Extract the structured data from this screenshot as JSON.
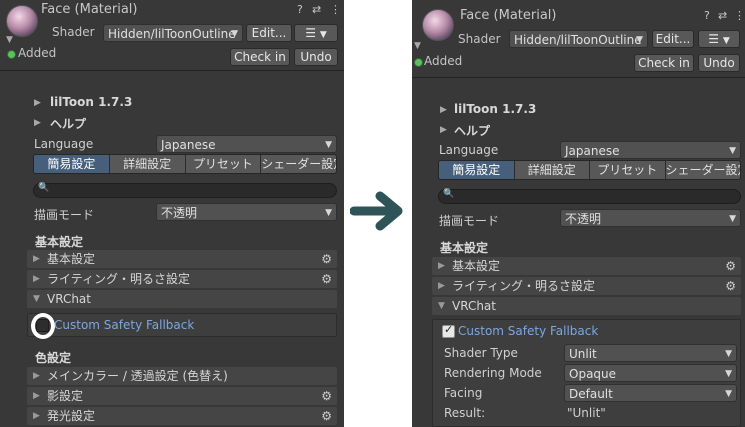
{
  "header": {
    "title": "Face (Material)",
    "shader_label": "Shader",
    "shader_value": "Hidden/lilToonOutline",
    "shader_value_right": "Hidden/lilToonOutline",
    "edit_label": "Edit...",
    "list_glyph": "☰",
    "help_glyph": "?",
    "settings_glyph": "⇄",
    "more_glyph": "⋮",
    "added_label": "Added",
    "checkin_label": "Check in",
    "undo_label": "Undo"
  },
  "lil": {
    "version_label": "lilToon 1.7.3",
    "help_label": "ヘルプ",
    "language_label": "Language",
    "language_value": "Japanese",
    "tabs": [
      "簡易設定",
      "詳細設定",
      "プリセット",
      "シェーダー設定"
    ],
    "render_mode_label": "描画モード",
    "render_mode_value": "不透明",
    "basic_header": "基本設定",
    "color_header": "色設定",
    "foldouts": {
      "basic": "基本設定",
      "lighting": "ライティング・明るさ設定",
      "vrchat": "VRChat",
      "main_color": "メインカラー / 透過設定 (色替え)",
      "shadow": "影設定",
      "emission": "発光設定"
    }
  },
  "vrchat": {
    "fallback_label": "Custom Safety Fallback",
    "shader_type_label": "Shader Type",
    "shader_type_value": "Unlit",
    "rendering_mode_label": "Rendering Mode",
    "rendering_mode_value": "Opaque",
    "facing_label": "Facing",
    "facing_value": "Default",
    "result_label": "Result:",
    "result_value": "\"Unlit\""
  },
  "colors": {
    "panel_bg": "#383838",
    "active_tab": "#46607c",
    "fallback_label": "#7ba7e0",
    "arrow": "#2f5457"
  },
  "icons": [
    "avatar-icon",
    "help-icon",
    "preset-icon",
    "more-icon",
    "search-icon",
    "gear-icon",
    "foldout-triangle-icon",
    "checkmark-icon",
    "arrow-right-icon"
  ]
}
